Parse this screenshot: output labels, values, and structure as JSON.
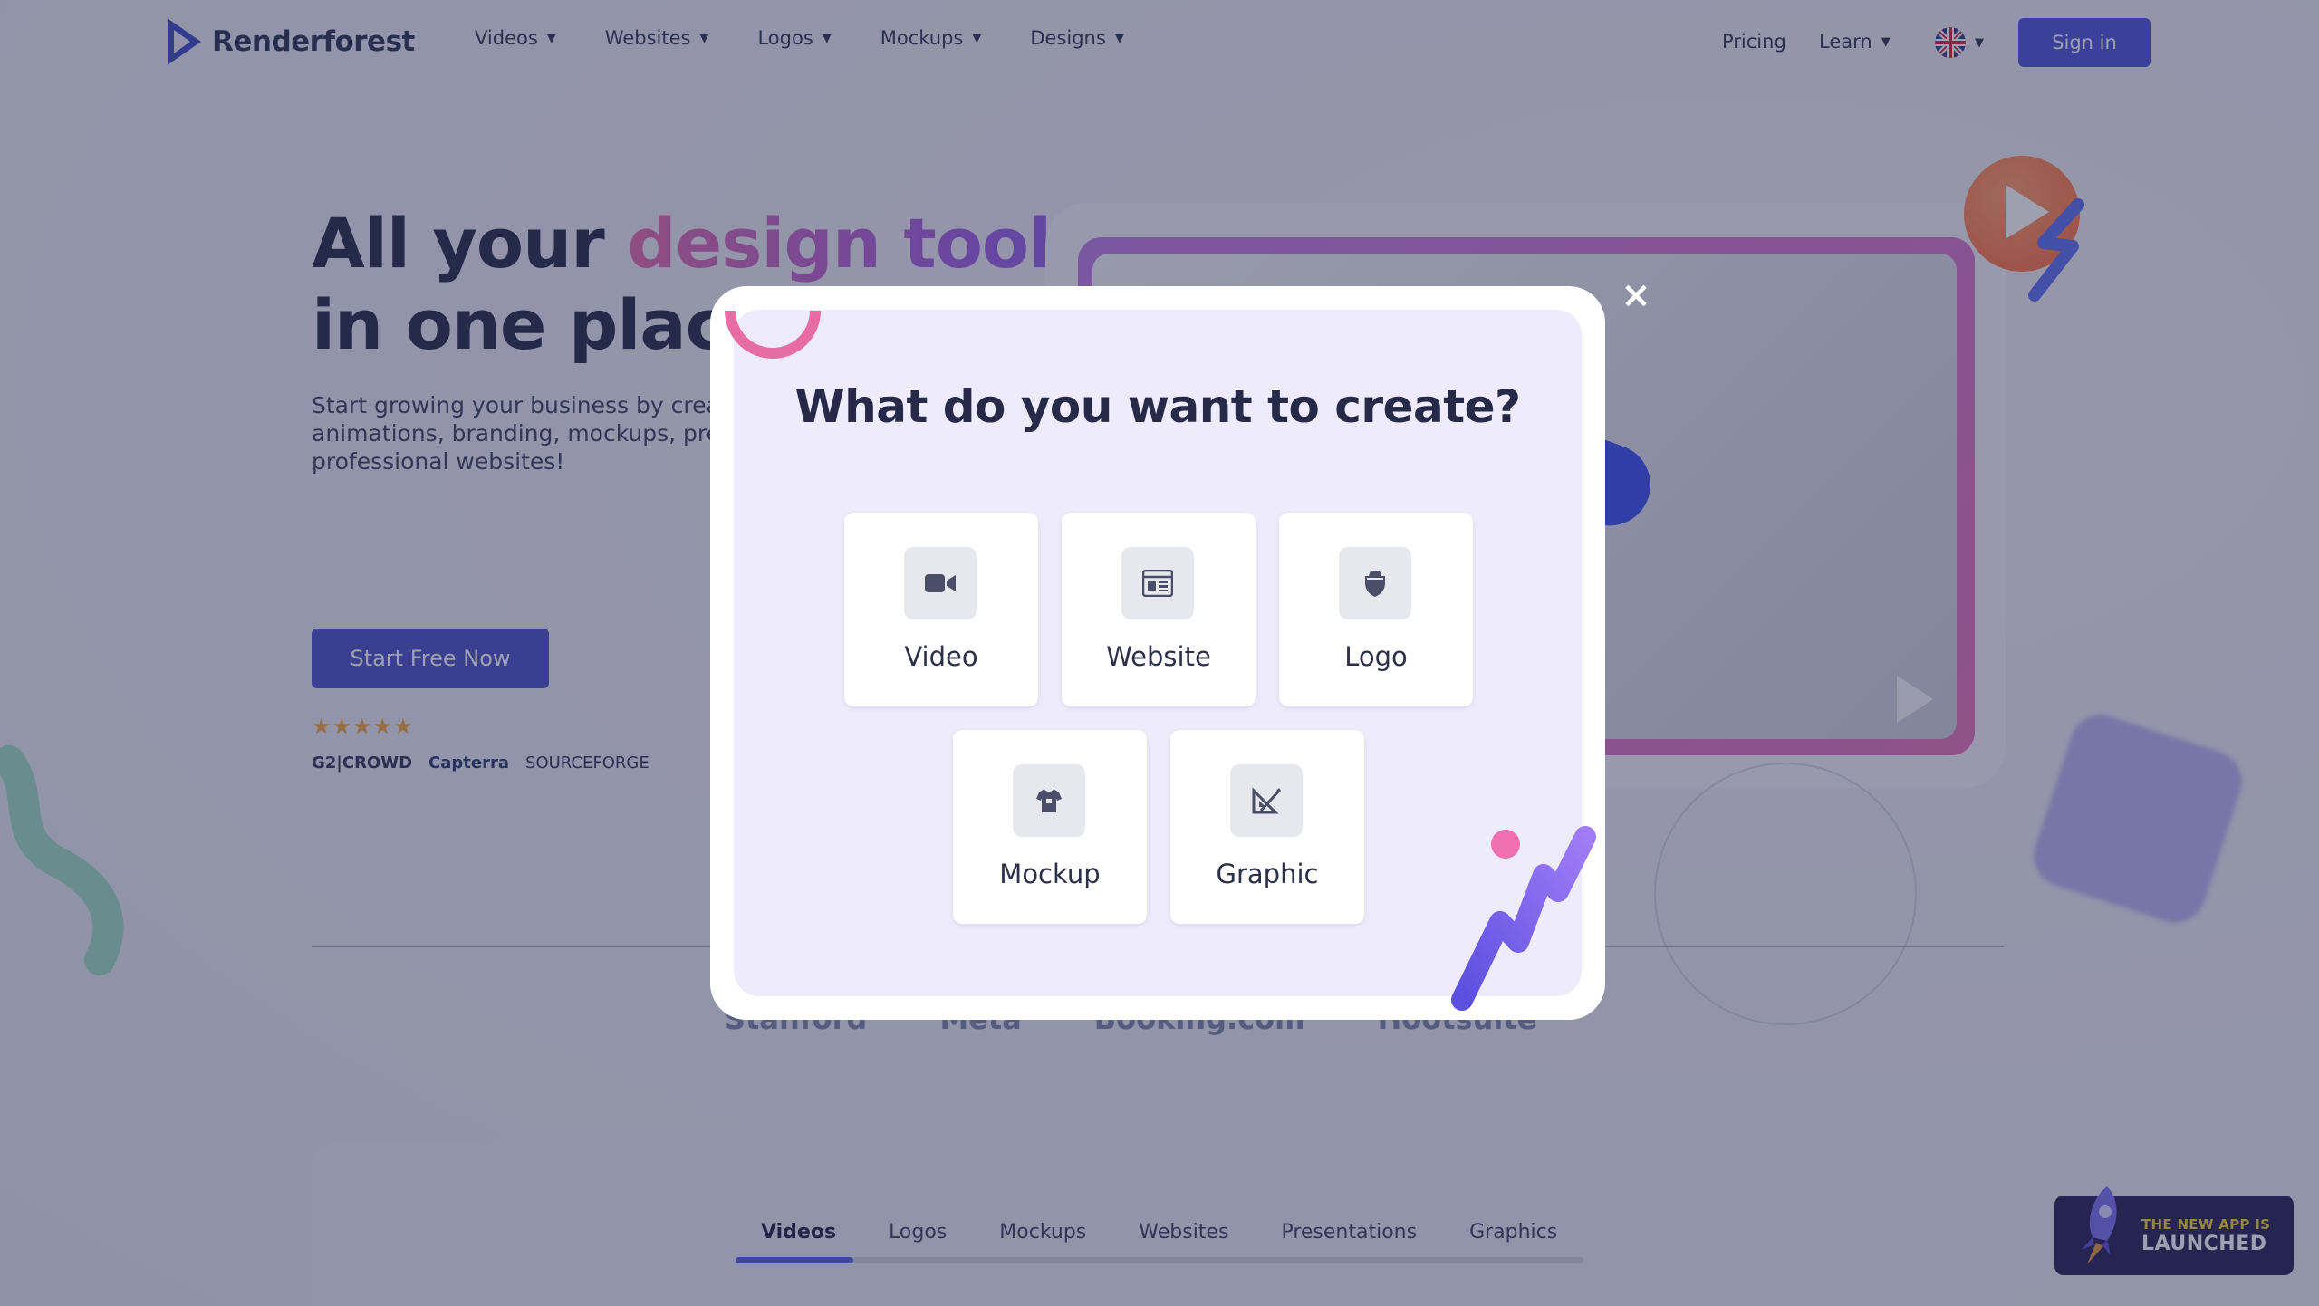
{
  "brand": {
    "name": "Renderforest"
  },
  "nav": {
    "items": [
      {
        "label": "Videos"
      },
      {
        "label": "Websites"
      },
      {
        "label": "Logos"
      },
      {
        "label": "Mockups"
      },
      {
        "label": "Designs"
      }
    ],
    "pricing": "Pricing",
    "learn": "Learn",
    "language_icon": "uk-flag-icon",
    "signin": "Sign in"
  },
  "hero": {
    "title_line1_start": "All your ",
    "title_line1_accent": "design tools",
    "title_line2": "in one place",
    "subtitle_line1": "Start growing your business by creat",
    "subtitle_line2": "animations, branding, mockups, pres",
    "subtitle_line3": "professional websites!",
    "cta": "Start Free Now",
    "stars": "★★★★★",
    "rating": 5,
    "reviews": {
      "g2": "G2|CROWD",
      "capterra": "Capterra",
      "sourceforge": "SOURCEFORGE"
    }
  },
  "brands": [
    "Stanford",
    "Meta",
    "Booking.com",
    "Hootsuite"
  ],
  "gallery": {
    "tabs": [
      "Videos",
      "Logos",
      "Mockups",
      "Websites",
      "Presentations",
      "Graphics"
    ],
    "active_tab": "Videos"
  },
  "app_badge": {
    "line1": "THE NEW APP IS",
    "line2": "LAUNCHED"
  },
  "modal": {
    "title": "What do you want to create?",
    "close": "×",
    "options": [
      {
        "label": "Video",
        "icon": "video-camera-icon"
      },
      {
        "label": "Website",
        "icon": "browser-window-icon"
      },
      {
        "label": "Logo",
        "icon": "shield-crest-icon"
      },
      {
        "label": "Mockup",
        "icon": "tshirt-icon"
      },
      {
        "label": "Graphic",
        "icon": "ruler-triangle-icon"
      }
    ]
  },
  "colors": {
    "primary": "#4c52d8",
    "accent_pink": "#e46aa8",
    "accent_purple": "#a25ce0",
    "modal_bg": "#eeecfc",
    "overlay": "rgba(40,44,80,0.45)"
  }
}
